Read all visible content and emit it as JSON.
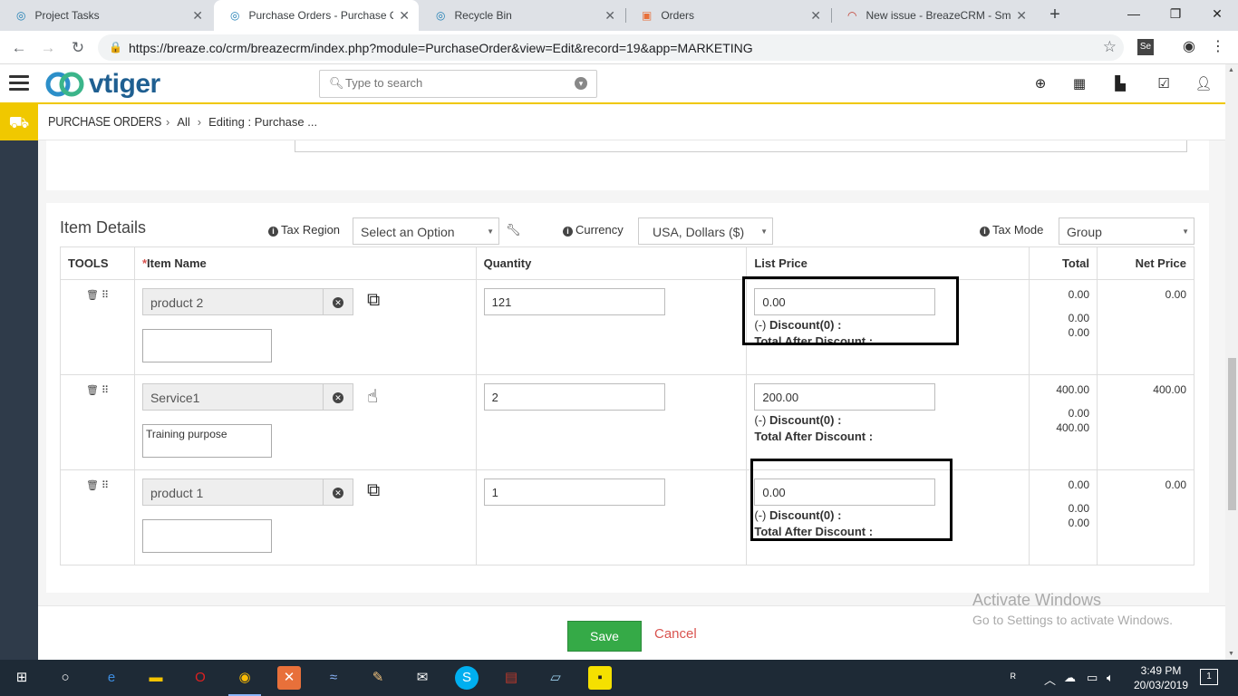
{
  "browser": {
    "tabs": [
      {
        "title": "Project Tasks"
      },
      {
        "title": "Purchase Orders - Purchase Or"
      },
      {
        "title": "Recycle Bin"
      },
      {
        "title": "Orders"
      },
      {
        "title": "New issue - BreazeCRM - Sma"
      }
    ],
    "url": "https://breaze.co/crm/breazecrm/index.php?module=PurchaseOrder&view=Edit&record=19&app=MARKETING"
  },
  "app": {
    "logo_text": "vtiger",
    "search_placeholder": "Type to search",
    "breadcrumb": {
      "module": "PURCHASE ORDERS",
      "all": "All",
      "current": "Editing : Purchase ..."
    }
  },
  "items": {
    "title": "Item Details",
    "tax_region_label": "Tax Region",
    "tax_region_value": "Select an Option",
    "currency_label": "Currency",
    "currency_value": "USA, Dollars ($)",
    "tax_mode_label": "Tax Mode",
    "tax_mode_value": "Group",
    "columns": {
      "tools": "TOOLS",
      "item_name": "Item Name",
      "quantity": "Quantity",
      "list_price": "List Price",
      "total": "Total",
      "net_price": "Net Price"
    },
    "required_mark": "*",
    "discount_prefix": "(-)",
    "rows": [
      {
        "name": "product 2",
        "type": "product",
        "comment": "",
        "quantity": "121",
        "list_price": "0.00",
        "discount": "Discount(0) :",
        "total_after_discount": "Total After Discount :",
        "total": "0.00",
        "discount_amount": "0.00",
        "after_discount": "0.00",
        "net_price": "0.00"
      },
      {
        "name": "Service1",
        "type": "service",
        "comment": "Training purpose",
        "quantity": "2",
        "list_price": "200.00",
        "discount": "Discount(0) :",
        "total_after_discount": "Total After Discount :",
        "total": "400.00",
        "discount_amount": "0.00",
        "after_discount": "400.00",
        "net_price": "400.00"
      },
      {
        "name": "product 1",
        "type": "product",
        "comment": "",
        "quantity": "1",
        "list_price": "0.00",
        "discount": "Discount(0) :",
        "total_after_discount": "Total After Discount :",
        "total": "0.00",
        "discount_amount": "0.00",
        "after_discount": "0.00",
        "net_price": "0.00"
      }
    ]
  },
  "footer": {
    "save": "Save",
    "cancel": "Cancel"
  },
  "watermark": {
    "line1": "Activate Windows",
    "line2": "Go to Settings to activate Windows."
  },
  "taskbar": {
    "time": "3:49 PM",
    "date": "20/03/2019",
    "notifications": "1"
  },
  "colors": {
    "accent": "#f0c800",
    "save": "#35aa47",
    "cancel": "#d9534f",
    "sidebar": "#2f3b4a"
  }
}
